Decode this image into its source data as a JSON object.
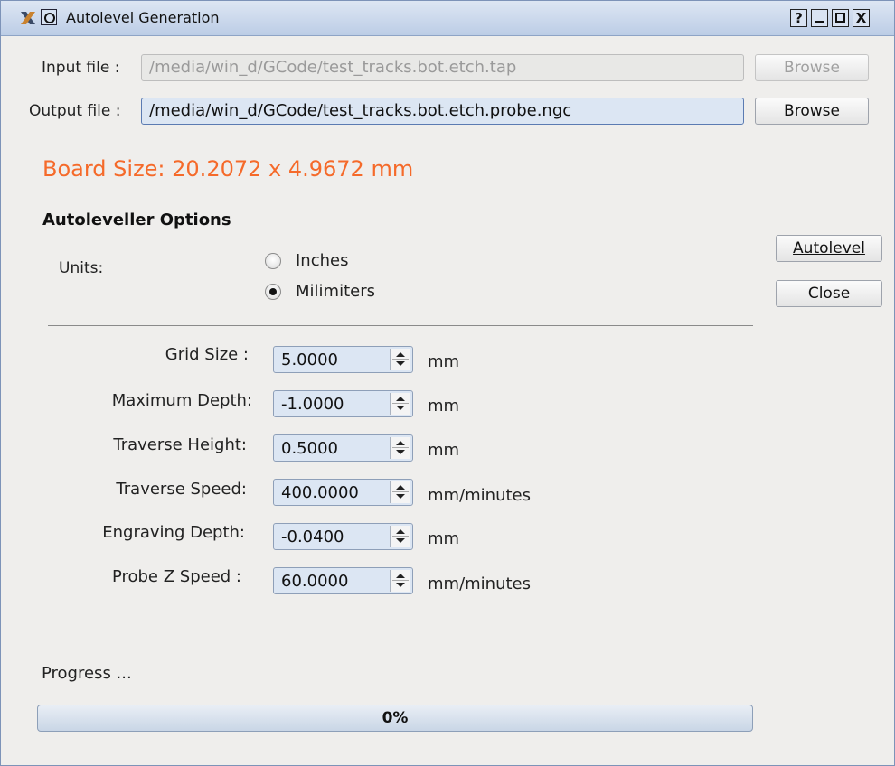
{
  "window": {
    "title": "Autolevel Generation",
    "help_label": "?",
    "min_label": "_",
    "max_label": "□",
    "close_label": "X"
  },
  "files": {
    "input_label": "Input file :",
    "input_value": "/media/win_d/GCode/test_tracks.bot.etch.tap",
    "input_browse": "Browse",
    "output_label": "Output file :",
    "output_value": "/media/win_d/GCode/test_tracks.bot.etch.probe.ngc",
    "output_browse": "Browse"
  },
  "board_size": "Board Size: 20.2072 x 4.9672 mm",
  "options": {
    "title": "Autoleveller Options",
    "units_label": "Units:",
    "units": [
      {
        "label": "Inches",
        "checked": false
      },
      {
        "label": "Milimiters",
        "checked": true
      }
    ]
  },
  "actions": {
    "autolevel": "Autolevel",
    "close": "Close"
  },
  "params": [
    {
      "label": "Grid Size :",
      "value": "5.0000",
      "unit": "mm"
    },
    {
      "label": "Maximum Depth:",
      "value": "-1.0000",
      "unit": "mm"
    },
    {
      "label": "Traverse Height:",
      "value": "0.5000",
      "unit": "mm"
    },
    {
      "label": "Traverse Speed:",
      "value": "400.0000",
      "unit": "mm/minutes"
    },
    {
      "label": "Engraving Depth:",
      "value": "-0.0400",
      "unit": "mm"
    },
    {
      "label": "Probe Z Speed :",
      "value": "60.0000",
      "unit": "mm/minutes"
    }
  ],
  "progress": {
    "label": "Progress ...",
    "value": 0,
    "text": "0%"
  },
  "colors": {
    "board_size": "#f56a2a",
    "titlebar": "#c6d4ea"
  }
}
